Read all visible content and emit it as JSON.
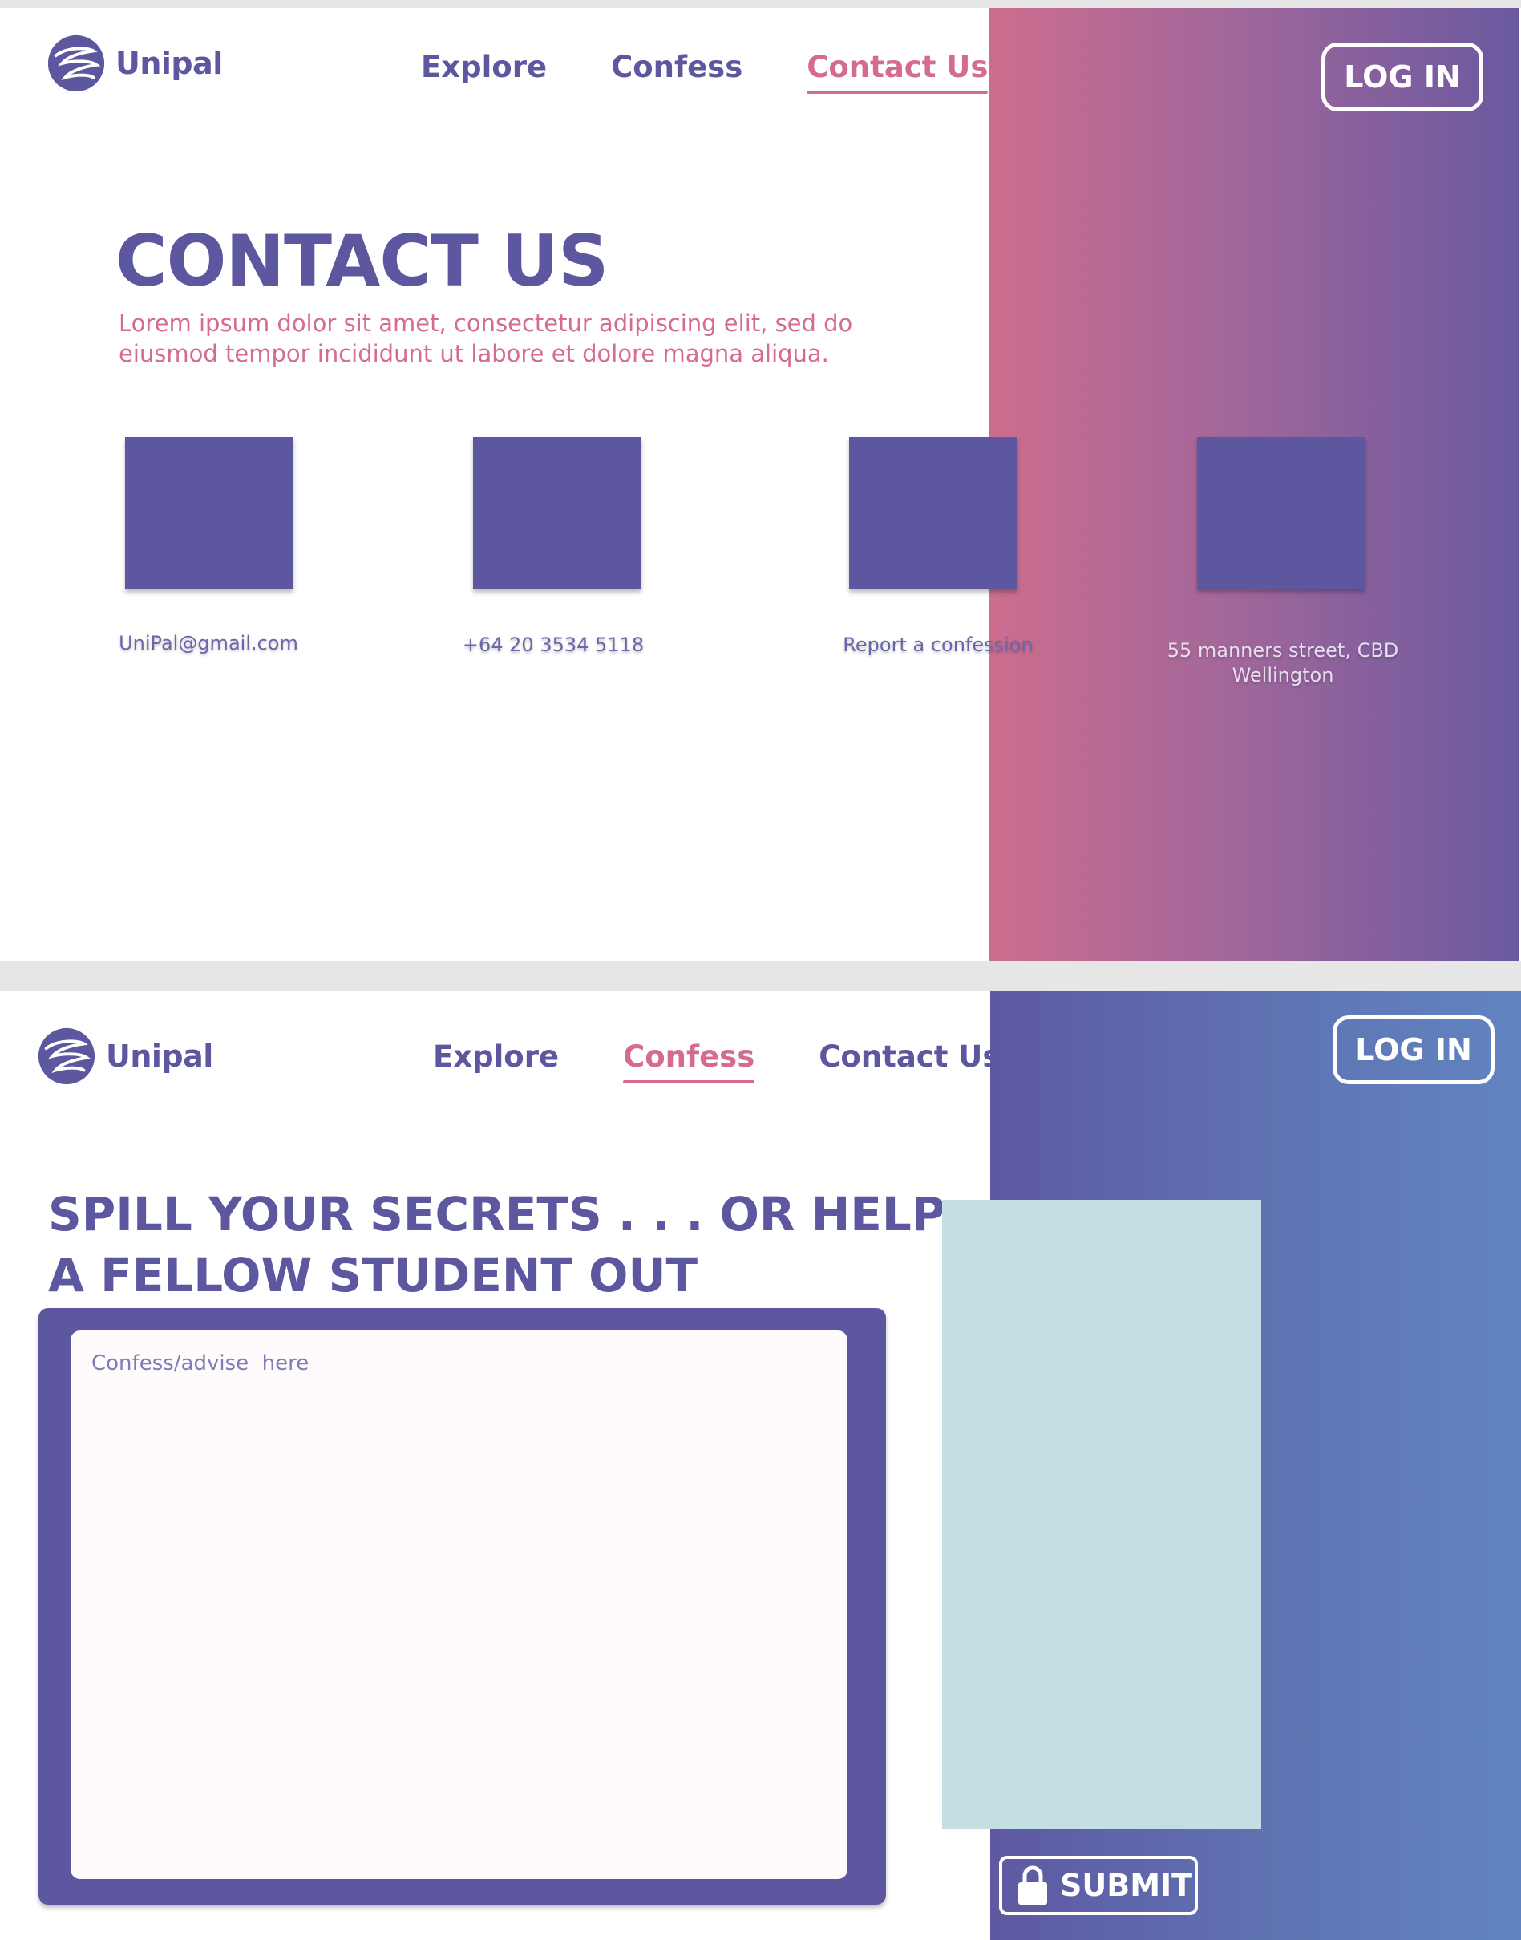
{
  "brand": {
    "name": "Unipal"
  },
  "colors": {
    "purple": "#5d57a0",
    "pink": "#d56c8e",
    "panel": "#c4dfe3"
  },
  "contact_page": {
    "nav": {
      "explore": "Explore",
      "confess": "Confess",
      "contact": "Contact Us",
      "active": "contact"
    },
    "login_label": "LOG IN",
    "title": "CONTACT US",
    "lead_line1": "Lorem ipsum dolor sit amet, consectetur adipiscing elit, sed do",
    "lead_line2": "eiusmod tempor incididunt ut labore et dolore magna aliqua.",
    "items": [
      {
        "label": "UniPal@gmail.com"
      },
      {
        "label": "+64 20 3534 5118"
      },
      {
        "label": "Report a confession"
      },
      {
        "label_line1": "55 manners street, CBD",
        "label_line2": "Wellington"
      }
    ]
  },
  "confess_page": {
    "nav": {
      "explore": "Explore",
      "confess": "Confess",
      "contact": "Contact Us",
      "active": "confess"
    },
    "login_label": "LOG IN",
    "heading_line1": "SPILL YOUR SECRETS . . . OR HELP",
    "heading_line2": "A FELLOW STUDENT OUT",
    "textarea_placeholder": "Confess/advise  here",
    "submit_label": "SUBMIT",
    "icons": {
      "submit": "lock-icon",
      "logo": "globe-logo-icon"
    }
  }
}
